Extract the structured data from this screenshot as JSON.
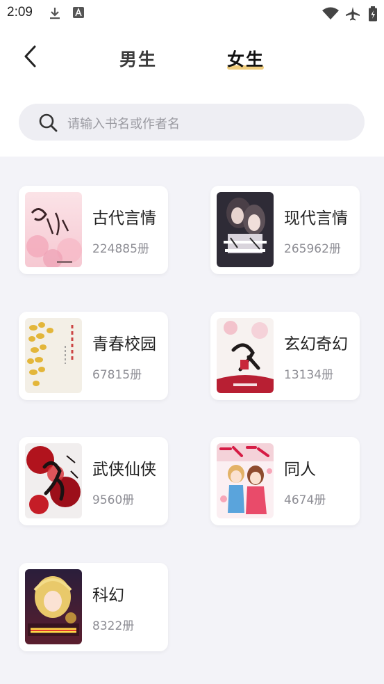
{
  "status_bar": {
    "time": "2:09"
  },
  "header": {
    "tabs": [
      {
        "label": "男生",
        "active": false
      },
      {
        "label": "女生",
        "active": true
      }
    ],
    "accent_color": "#f0cd7d"
  },
  "search": {
    "placeholder": "请输入书名或作者名"
  },
  "categories": [
    {
      "name": "古代言情",
      "count": "224885册"
    },
    {
      "name": "现代言情",
      "count": "265962册"
    },
    {
      "name": "青春校园",
      "count": "67815册"
    },
    {
      "name": "玄幻奇幻",
      "count": "13134册"
    },
    {
      "name": "武侠仙侠",
      "count": "9560册"
    },
    {
      "name": "同人",
      "count": "4674册"
    },
    {
      "name": "科幻",
      "count": "8322册"
    }
  ]
}
